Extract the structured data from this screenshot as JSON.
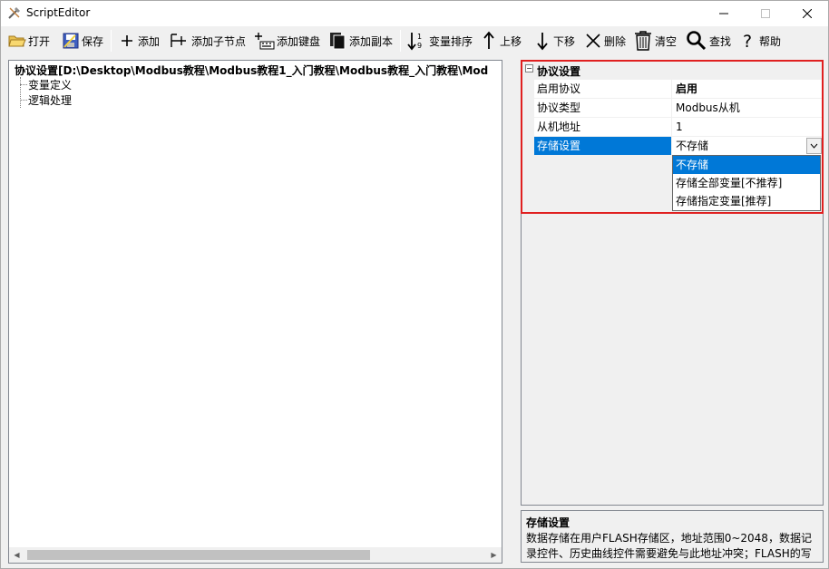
{
  "window": {
    "title": "ScriptEditor"
  },
  "toolbar": {
    "open": "打开",
    "save": "保存",
    "add": "添加",
    "add_child": "添加子节点",
    "add_keyboard": "添加键盘",
    "add_copy": "添加副本",
    "sort_vars": "变量排序",
    "move_up": "上移",
    "move_down": "下移",
    "delete": "删除",
    "clear": "清空",
    "find": "查找",
    "help": "帮助"
  },
  "tree": {
    "root": "协议设置[D:\\Desktop\\Modbus教程\\Modbus教程1_入门教程\\Modbus教程_入门教程\\Mod",
    "children": [
      "变量定义",
      "逻辑处理"
    ]
  },
  "properties": {
    "category": "协议设置",
    "rows": [
      {
        "name": "启用协议",
        "value": "启用"
      },
      {
        "name": "协议类型",
        "value": "Modbus从机"
      },
      {
        "name": "从机地址",
        "value": "1"
      },
      {
        "name": "存储设置",
        "value": "不存储"
      }
    ],
    "dropdown_options": [
      "不存储",
      "存储全部变量[不推荐]",
      "存储指定变量[推荐]"
    ],
    "selected_option": "不存储"
  },
  "description": {
    "title": "存储设置",
    "text": "数据存储在用户FLASH存储区，地址范围0~2048，数据记录控件、历史曲线控件需要避免与此地址冲突；FLASH的写寿"
  },
  "colors": {
    "selection": "#0078d7",
    "highlight": "#e02020"
  }
}
